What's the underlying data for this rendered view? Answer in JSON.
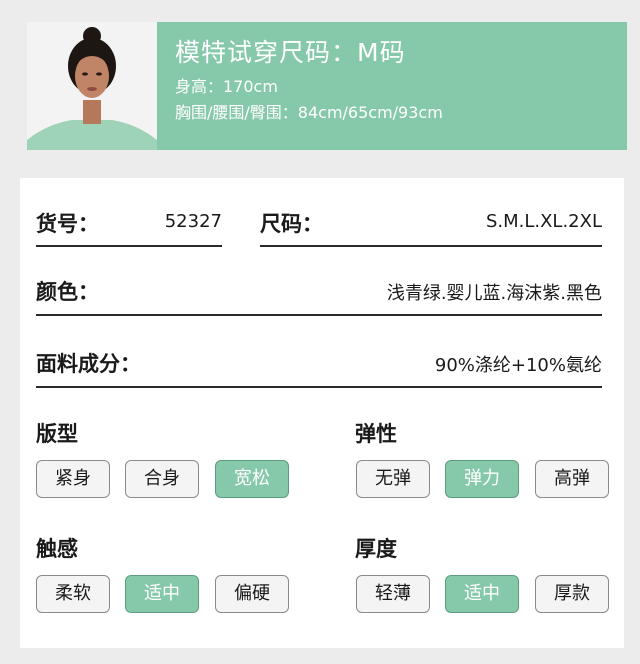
{
  "banner": {
    "title": "模特试穿尺码：M码",
    "height": "身高：170cm",
    "measurements": "胸围/腰围/臀围：84cm/65cm/93cm"
  },
  "specs": {
    "item_no_label": "货号：",
    "item_no_value": "52327",
    "size_label": "尺码：",
    "size_value": "S.M.L.XL.2XL",
    "color_label": "颜色：",
    "color_value": "浅青绿.婴儿蓝.海沫紫.黑色",
    "fabric_label": "面料成分：",
    "fabric_value": "90%涤纶+10%氨纶"
  },
  "attributes": {
    "fit": {
      "title": "版型",
      "options": [
        "紧身",
        "合身",
        "宽松"
      ],
      "selected": "宽松"
    },
    "elasticity": {
      "title": "弹性",
      "options": [
        "无弹",
        "弹力",
        "高弹"
      ],
      "selected": "弹力"
    },
    "touch": {
      "title": "触感",
      "options": [
        "柔软",
        "适中",
        "偏硬"
      ],
      "selected": "适中"
    },
    "thickness": {
      "title": "厚度",
      "options": [
        "轻薄",
        "适中",
        "厚款"
      ],
      "selected": "适中"
    }
  },
  "colors": {
    "accent": "#86c9aa",
    "accent_border": "#5e9c80"
  }
}
